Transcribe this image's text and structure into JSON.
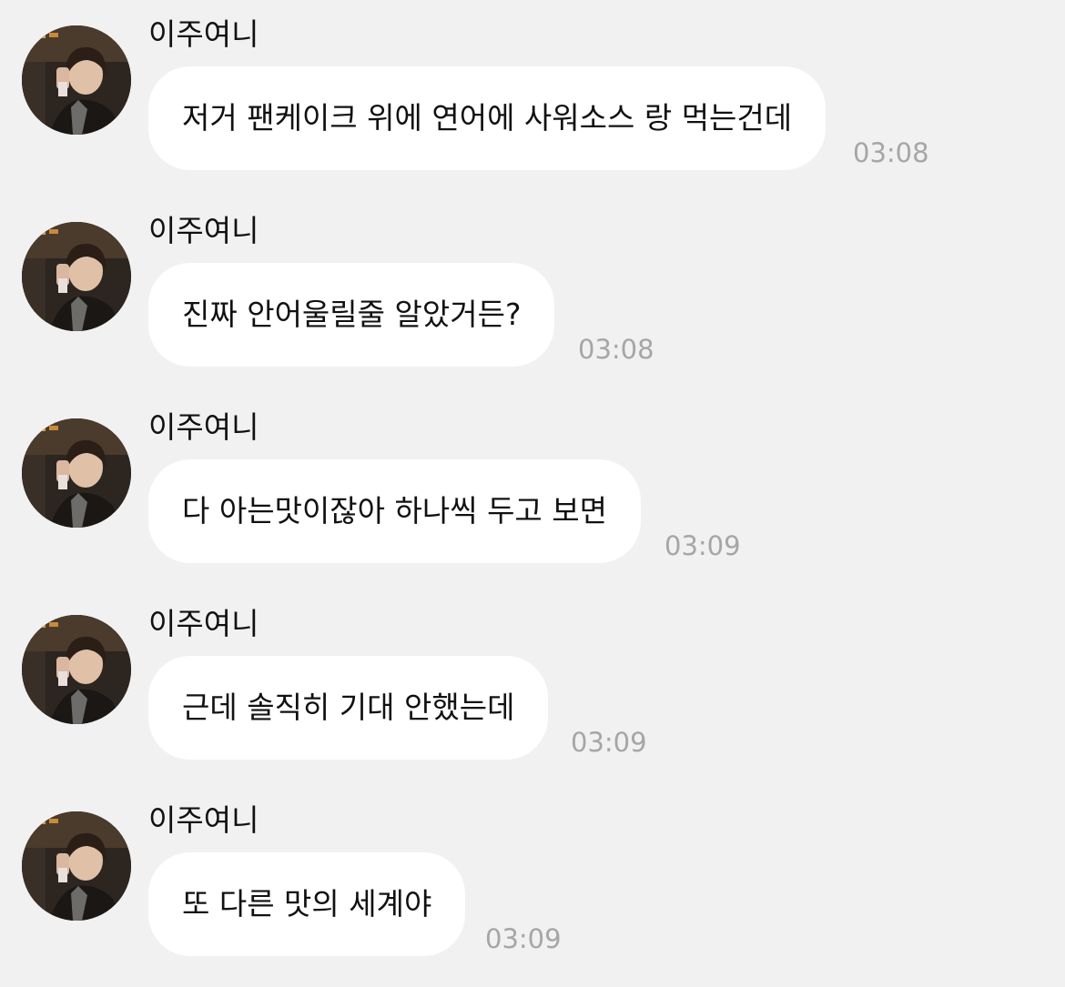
{
  "chat": {
    "messages": [
      {
        "sender": "이주여니",
        "text": "저거 팬케이크 위에 연어에 사워소스 랑 먹는건데",
        "time": "03:08"
      },
      {
        "sender": "이주여니",
        "text": "진짜 안어울릴줄 알았거든?",
        "time": "03:08"
      },
      {
        "sender": "이주여니",
        "text": "다 아는맛이잖아 하나씩 두고 보면",
        "time": "03:09"
      },
      {
        "sender": "이주여니",
        "text": "근데 솔직히 기대 안했는데",
        "time": "03:09"
      },
      {
        "sender": "이주여니",
        "text": "또 다른 맛의 세계야",
        "time": "03:09"
      }
    ]
  }
}
